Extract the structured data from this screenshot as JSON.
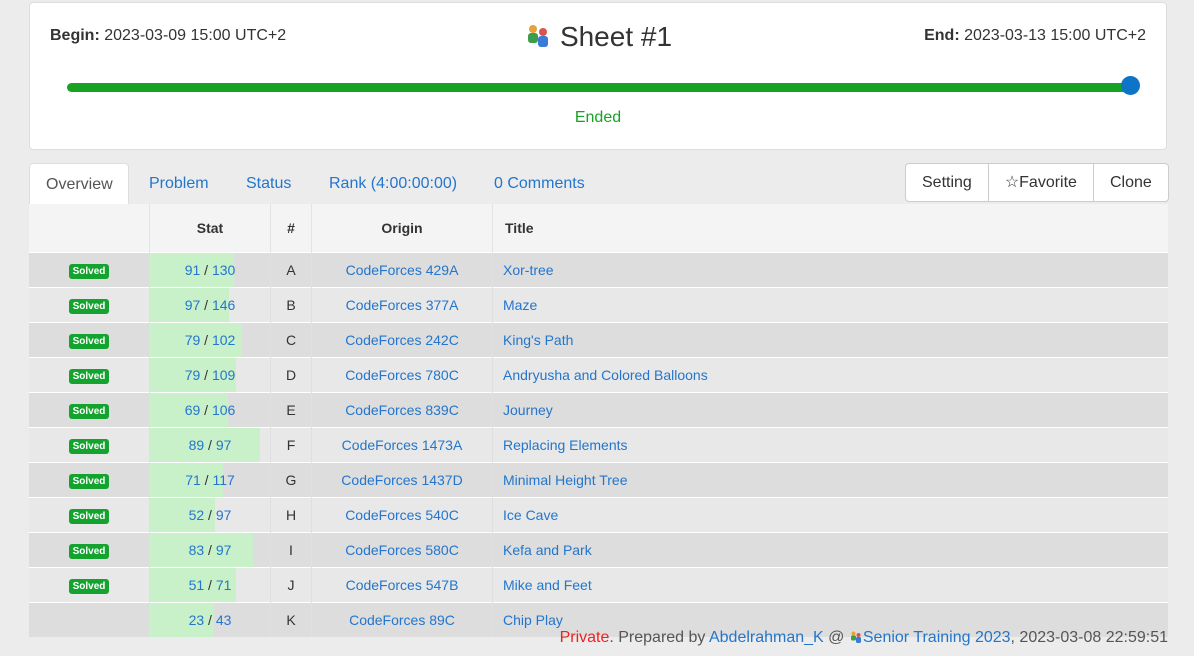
{
  "contest": {
    "begin_label": "Begin:",
    "begin_value": "2023-03-09 15:00 UTC+2",
    "title": "Sheet #1",
    "end_label": "End:",
    "end_value": "2023-03-13 15:00 UTC+2",
    "status": "Ended",
    "progress_percent": 100
  },
  "tabs": [
    "Overview",
    "Problem",
    "Status",
    "Rank (4:00:00:00)",
    "0 Comments"
  ],
  "buttons": {
    "setting": "Setting",
    "favorite": "Favorite",
    "clone": "Clone"
  },
  "table": {
    "headers": {
      "stat": "Stat",
      "num": "#",
      "origin": "Origin",
      "title": "Title"
    },
    "rows": [
      {
        "status": "Solved",
        "solved": "91",
        "total": "130",
        "ratio": 0.7,
        "num": "A",
        "origin": "CodeForces 429A",
        "title": "Xor-tree"
      },
      {
        "status": "Solved",
        "solved": "97",
        "total": "146",
        "ratio": 0.66,
        "num": "B",
        "origin": "CodeForces 377A",
        "title": "Maze"
      },
      {
        "status": "Solved",
        "solved": "79",
        "total": "102",
        "ratio": 0.77,
        "num": "C",
        "origin": "CodeForces 242C",
        "title": "King's Path"
      },
      {
        "status": "Solved",
        "solved": "79",
        "total": "109",
        "ratio": 0.72,
        "num": "D",
        "origin": "CodeForces 780C",
        "title": "Andryusha and Colored Balloons"
      },
      {
        "status": "Solved",
        "solved": "69",
        "total": "106",
        "ratio": 0.65,
        "num": "E",
        "origin": "CodeForces 839C",
        "title": "Journey"
      },
      {
        "status": "Solved",
        "solved": "89",
        "total": "97",
        "ratio": 0.92,
        "num": "F",
        "origin": "CodeForces 1473A",
        "title": "Replacing Elements"
      },
      {
        "status": "Solved",
        "solved": "71",
        "total": "117",
        "ratio": 0.61,
        "num": "G",
        "origin": "CodeForces 1437D",
        "title": "Minimal Height Tree"
      },
      {
        "status": "Solved",
        "solved": "52",
        "total": "97",
        "ratio": 0.54,
        "num": "H",
        "origin": "CodeForces 540C",
        "title": "Ice Cave"
      },
      {
        "status": "Solved",
        "solved": "83",
        "total": "97",
        "ratio": 0.86,
        "num": "I",
        "origin": "CodeForces 580C",
        "title": "Kefa and Park"
      },
      {
        "status": "Solved",
        "solved": "51",
        "total": "71",
        "ratio": 0.72,
        "num": "J",
        "origin": "CodeForces 547B",
        "title": "Mike and Feet"
      },
      {
        "status": "",
        "solved": "23",
        "total": "43",
        "ratio": 0.53,
        "num": "K",
        "origin": "CodeForces 89C",
        "title": "Chip Play"
      }
    ]
  },
  "footer": {
    "privacy": "Private",
    "prepared_by": ". Prepared by ",
    "author": "Abdelrahman_K",
    "at": " @ ",
    "group": "Senior Training 2023",
    "date": ", 2023-03-08 22:59:51"
  },
  "colors": {
    "accent": "#2376cc",
    "success": "#16a322",
    "knob": "#0e74c7",
    "stat_bar": "#c9f1c9"
  }
}
